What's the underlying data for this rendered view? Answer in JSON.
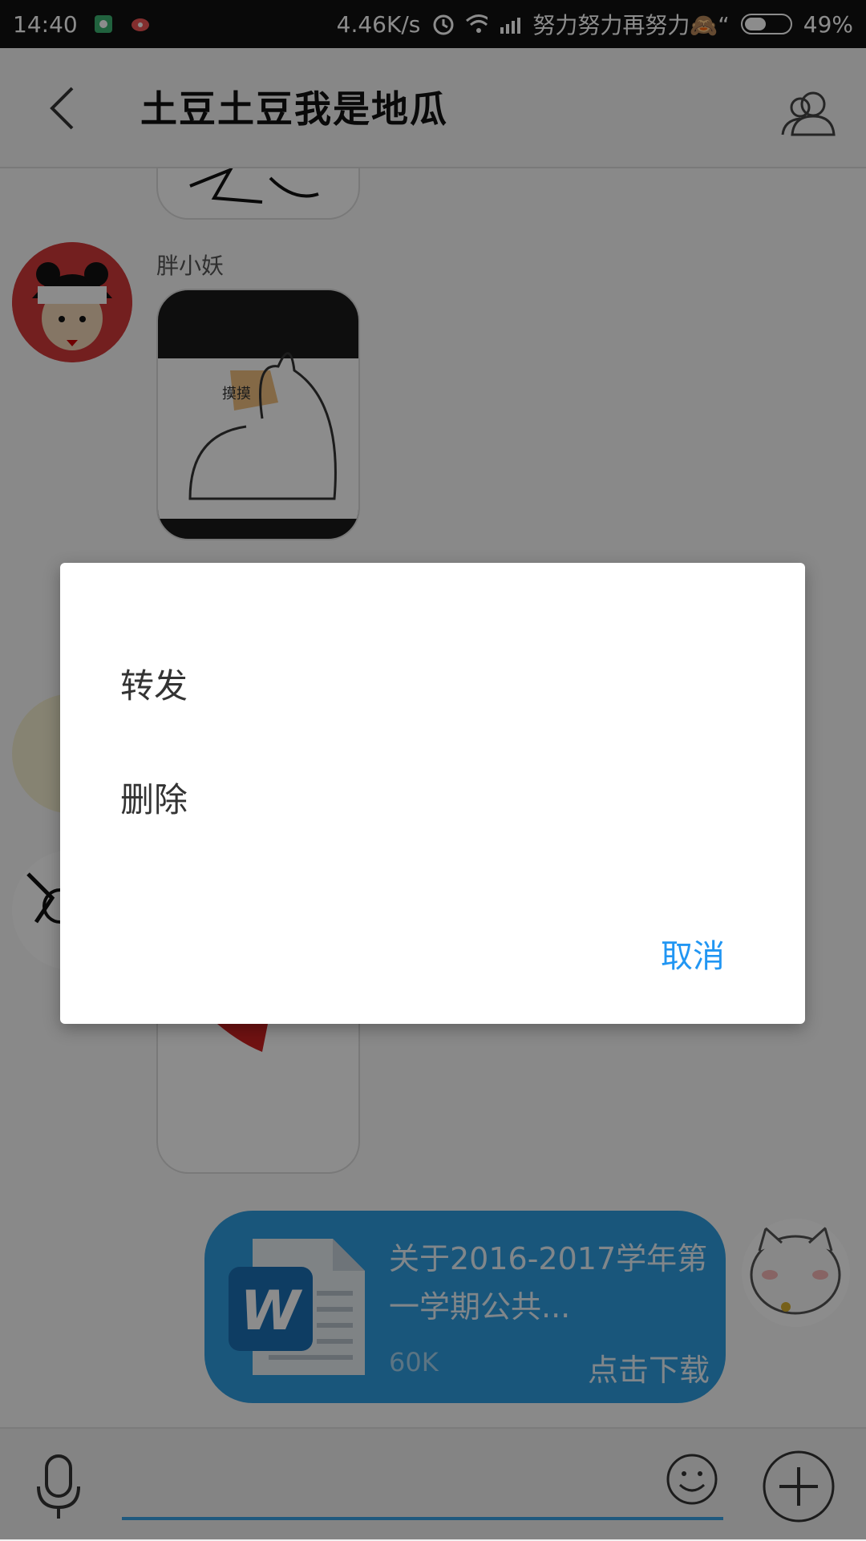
{
  "status_bar": {
    "time": "14:40",
    "net_speed": "4.46K/s",
    "carrier_text": "努力努力再努力🙈“",
    "battery_percent": "49%",
    "battery_level": 0.49
  },
  "header": {
    "title": "土豆土豆我是地瓜"
  },
  "chat": {
    "sender_name": "胖小妖",
    "file_message": {
      "name": "关于2016-2017学年第一学期公共...",
      "size": "60K",
      "action": "点击下载",
      "icon_letter": "W"
    }
  },
  "dialog": {
    "items": [
      "转发",
      "删除"
    ],
    "cancel": "取消"
  },
  "colors": {
    "accent": "#2196f3",
    "bubble": "#2f9de0",
    "overlay": "rgba(0,0,0,0.45)"
  }
}
